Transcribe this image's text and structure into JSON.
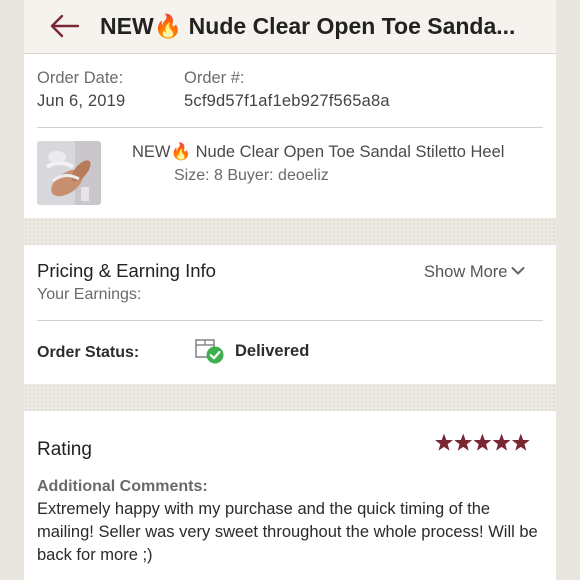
{
  "header": {
    "back_icon": "arrow-left-icon",
    "title": "NEW🔥 Nude Clear Open Toe Sanda...",
    "accent_color": "#7a2733"
  },
  "order": {
    "date_label": "Order Date:",
    "date_value": "Jun 6, 2019",
    "number_label": "Order #:",
    "number_value": "5cf9d57f1af1eb927f565a8a"
  },
  "listing": {
    "thumbnail": "product-photo",
    "title": "NEW🔥 Nude Clear Open Toe Sandal Stiletto Heel",
    "details": "Size: 8  Buyer: deoeliz"
  },
  "pricing": {
    "title": "Pricing & Earning Info",
    "show_more_label": "Show More",
    "earnings_label": "Your Earnings:"
  },
  "status": {
    "label": "Order Status:",
    "icon": "package-delivered-icon",
    "value": "Delivered",
    "status_color": "#3fae4f"
  },
  "rating": {
    "label": "Rating",
    "stars": 5,
    "max_stars": 5,
    "star_color": "#7a2733",
    "comments_label": "Additional Comments:",
    "comments": "Extremely happy with my purchase and the quick timing of the mailing! Seller was very sweet throughout the whole process! Will be back for more ;)"
  }
}
